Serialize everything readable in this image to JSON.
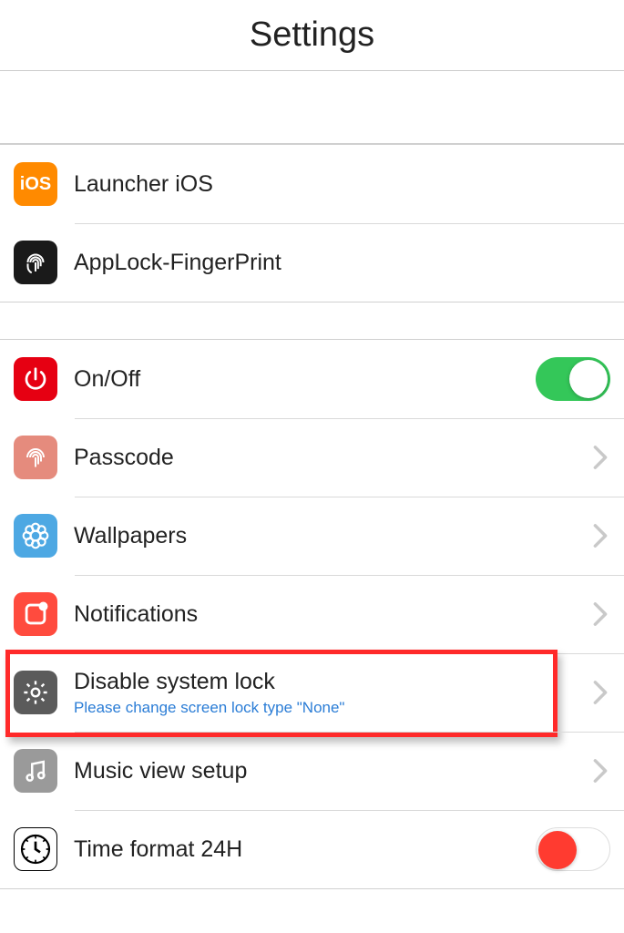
{
  "header": {
    "title": "Settings"
  },
  "group1": [
    {
      "label": "Launcher iOS"
    },
    {
      "label": "AppLock-FingerPrint"
    }
  ],
  "group2": {
    "onoff": {
      "label": "On/Off",
      "toggle": true
    },
    "passcode": {
      "label": "Passcode"
    },
    "wallpapers": {
      "label": "Wallpapers"
    },
    "notifications": {
      "label": "Notifications"
    },
    "disable_lock": {
      "label": "Disable system lock",
      "subtitle": "Please change screen lock type \"None\""
    },
    "music": {
      "label": "Music view setup"
    },
    "time24": {
      "label": "Time format 24H",
      "toggle": false
    }
  },
  "ios_text": "iOS"
}
